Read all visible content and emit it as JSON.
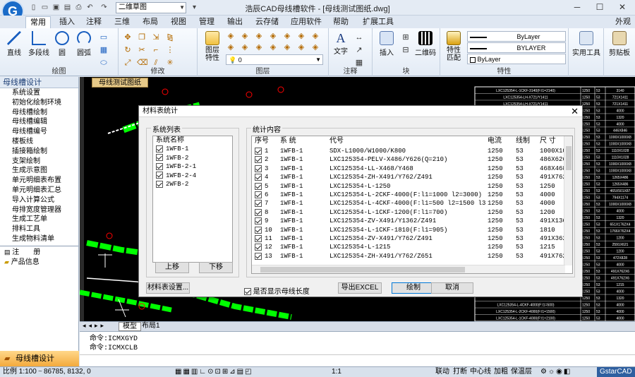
{
  "app_title": "浩辰CAD母线槽软件 - [母线测试图纸.dwg]",
  "workspace": "二维草图",
  "ribbon_tabs": [
    "常用",
    "插入",
    "注释",
    "三维",
    "布局",
    "视图",
    "管理",
    "输出",
    "云存储",
    "应用软件",
    "帮助",
    "扩展工具"
  ],
  "appearance_label": "外观",
  "ribbon_groups": {
    "draw": {
      "label": "绘图",
      "buttons": [
        "直线",
        "多段线",
        "圆",
        "圆弧"
      ]
    },
    "modify": {
      "label": "修改"
    },
    "layers": {
      "label": "图层",
      "properties": "图层特性",
      "layer_value": "0"
    },
    "annotate": {
      "label": "注释",
      "text": "文字"
    },
    "block": {
      "label": "块",
      "insert": "插入",
      "qrcode": "二维码"
    },
    "properties": {
      "label": "特性",
      "match": "特性匹配",
      "bylayer1": "ByLayer",
      "bylayer2": "BYLAYER",
      "bylayer3": "ByLayer"
    },
    "tools": {
      "utility": "实用工具",
      "clipboard": "剪贴板"
    }
  },
  "left_panel": {
    "title": "母线槽设计",
    "items": [
      "系统设置",
      "初始化绘制环境",
      "母线槽绘制",
      "母线槽编辑",
      "母线槽编号",
      "楼板线",
      "插接箱绘制",
      "支架绘制",
      "生成示意图",
      "单元明细表布置",
      "单元明细表汇总",
      "导入计算公式",
      "母排宽度管理器",
      "生成工艺单",
      "排料工具",
      "生成物料清单"
    ],
    "extra_items": [
      "注　　册",
      "产品信息"
    ],
    "bottom_label": "母线槽设计"
  },
  "drawing_tab": "母线测试图纸",
  "model_tabs": [
    "模型",
    "布局1"
  ],
  "command_lines": [
    "命令:ICMXGYD",
    "命令:ICMXCLB"
  ],
  "status": {
    "scale": "比例 1:100",
    "coords": "86785, 8132, 0",
    "ratio": "1:1",
    "items": [
      "联动",
      "打断",
      "中心线",
      "加粗",
      "保温层"
    ],
    "brand": "GstarCAD"
  },
  "dialog": {
    "title": "材料表统计",
    "system_list_label": "系统列表",
    "system_name_header": "系统名称",
    "systems": [
      "1WFB-1",
      "1WFB-2",
      "1WFB-2-1",
      "1WFB-2-4",
      "2WFB-2"
    ],
    "move_up": "上移",
    "move_down": "下移",
    "material_settings": "材料表设置...",
    "stats_label": "统计内容",
    "columns": [
      "序号",
      "系 统",
      "代号",
      "电流",
      "线制",
      "尺 寸"
    ],
    "rows": [
      [
        "1",
        "1WFB-1",
        "SDX-L1000/W1000/K800",
        "1250",
        "53",
        "1000X1000"
      ],
      [
        "2",
        "1WFB-1",
        "LXC125354-PELV-X486/Y626(Q=210)",
        "1250",
        "53",
        "486X626"
      ],
      [
        "3",
        "1WFB-1",
        "LXC125354-LL-X468/Y468",
        "1250",
        "53",
        "468X468"
      ],
      [
        "4",
        "1WFB-1",
        "LXC125354-ZH-X491/Y762/Z491",
        "1250",
        "53",
        "491X762X"
      ],
      [
        "5",
        "1WFB-1",
        "LXC125354-L-1250",
        "1250",
        "53",
        "1250"
      ],
      [
        "6",
        "1WFB-1",
        "LXC125354-L-2CKF-4000(F:l1=1000 l2=3000)",
        "1250",
        "53",
        "4000"
      ],
      [
        "7",
        "1WFB-1",
        "LXC125354-L-4CKF-4000(F:l1=500 l2=1500 l3=250...",
        "1250",
        "53",
        "4000"
      ],
      [
        "8",
        "1WFB-1",
        "LXC125354-L-1CKF-1200(F:l1=700)",
        "1250",
        "53",
        "1200"
      ],
      [
        "9",
        "1WFB-1",
        "LXC125354-ZV-X491/Y1362/Z491",
        "1250",
        "53",
        "491X1362"
      ],
      [
        "10",
        "1WFB-1",
        "LXC125354-L-1CKF-1810(F:l1=905)",
        "1250",
        "53",
        "1810"
      ],
      [
        "11",
        "1WFB-1",
        "LXC125354-ZV-X491/Y762/Z491",
        "1250",
        "53",
        "491X362X"
      ],
      [
        "12",
        "1WFB-1",
        "LXC125354-L-1215",
        "1250",
        "53",
        "1215"
      ],
      [
        "13",
        "1WFB-1",
        "LXC125354-ZH-X491/Y762/Z651",
        "1250",
        "53",
        "491X762X"
      ]
    ],
    "show_length_label": "是否显示母线长度",
    "export_button": "导出EXCEL",
    "draw_button": "绘制",
    "cancel_button": "取消"
  },
  "table_right": {
    "rows": [
      [
        "LXC125354-L-1CKF-3140(F:l1=2140)",
        "1250",
        "53",
        "3140"
      ],
      [
        "LXC125354-LH-X721/Y1411",
        "1250",
        "53",
        "721X1411"
      ],
      [
        "LXC125354-LH-X721/Y1411",
        "1250",
        "53",
        "721X1411"
      ],
      [
        "",
        "1250",
        "53",
        "4000"
      ],
      [
        "",
        "1250",
        "53",
        "1320"
      ],
      [
        "",
        "1250",
        "53",
        "4000"
      ],
      [
        "",
        "1250",
        "53",
        "446X846"
      ],
      [
        "",
        "1250",
        "53",
        "1000X1000X8"
      ],
      [
        "",
        "1250",
        "53",
        "1000X1000X8"
      ],
      [
        "",
        "1250",
        "53",
        "1110X1028"
      ],
      [
        "",
        "1250",
        "53",
        "1110X1028"
      ],
      [
        "",
        "1250",
        "53",
        "1000X1000X8"
      ],
      [
        "",
        "1250",
        "53",
        "1000X1000X8"
      ],
      [
        "",
        "1250",
        "53",
        "1265X486"
      ],
      [
        "",
        "1250",
        "53",
        "1265X486"
      ],
      [
        "",
        "1250",
        "53",
        "465X501X87"
      ],
      [
        "",
        "1250",
        "53",
        "794X1174"
      ],
      [
        "",
        "1250",
        "53",
        "1000X1000X8"
      ],
      [
        "",
        "1250",
        "53",
        "4000"
      ],
      [
        "",
        "1250",
        "53",
        "1320"
      ],
      [
        "",
        "1250",
        "53",
        "651X1762X4"
      ],
      [
        "",
        "1250",
        "53",
        "1766X762X4"
      ],
      [
        "",
        "1250",
        "53",
        "1200"
      ],
      [
        "",
        "1250",
        "53",
        "2591X621"
      ],
      [
        "",
        "1250",
        "53",
        "1200"
      ],
      [
        "",
        "1250",
        "53",
        "472X828"
      ],
      [
        "",
        "1250",
        "53",
        "4000"
      ],
      [
        "",
        "1250",
        "53",
        "491X762X6"
      ],
      [
        "",
        "1250",
        "53",
        "491X762X6"
      ],
      [
        "",
        "1250",
        "53",
        "1215"
      ],
      [
        "",
        "1250",
        "53",
        "4000"
      ],
      [
        "",
        "1250",
        "53",
        "1320"
      ],
      [
        "LXC125354-L-4CKF-4000(F:l1=500)",
        "1250",
        "53",
        "4000"
      ],
      [
        "LXC125354-L-2CKF-4000(F:l1=1500)",
        "1250",
        "53",
        "4000"
      ],
      [
        "LXC125354-L-1CKF-4000(F:l1=2100)",
        "1250",
        "53",
        "4000"
      ]
    ]
  },
  "colors": {
    "accent": "#1a6bc8",
    "drawing_bg": "#000000",
    "busbar": "#00ff00",
    "marker": "#ff0000"
  }
}
